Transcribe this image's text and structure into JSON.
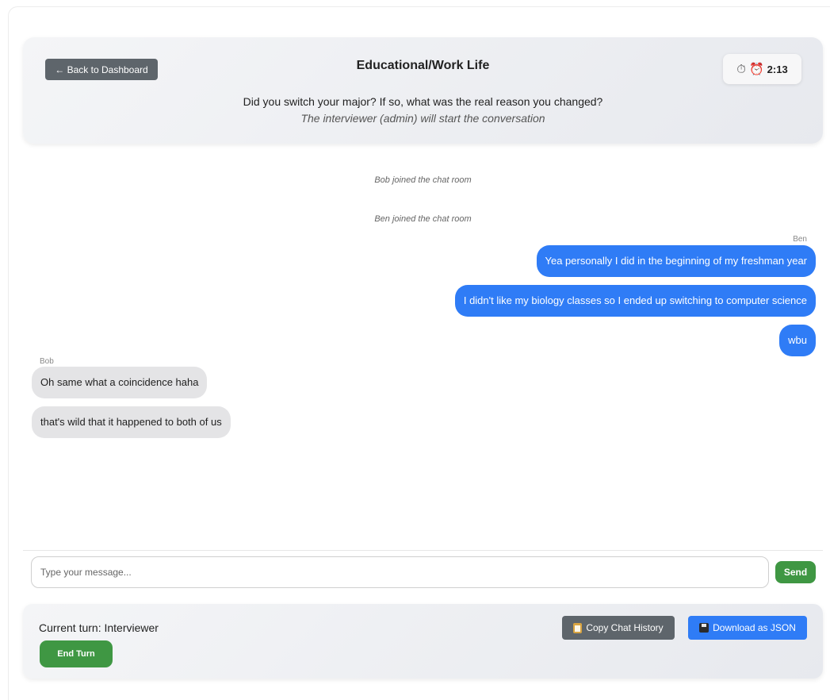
{
  "header": {
    "back_label": "← Back to Dashboard",
    "title": "Educational/Work Life",
    "question": "Did you switch your major? If so, what was the real reason you changed?",
    "note": "The interviewer (admin) will start the conversation",
    "timer": {
      "stopwatch_icon": "⏱",
      "alarm_icon": "⏰",
      "value": "2:13"
    }
  },
  "chat": {
    "system_messages": [
      "Bob joined the chat room",
      "Ben joined the chat room"
    ],
    "messages": [
      {
        "sender": "Ben",
        "text": "Yea personally I did in the beginning of my freshman year",
        "mine": true
      },
      {
        "sender": "Ben",
        "text": "I didn't like my biology classes so I ended up switching to computer science",
        "mine": true
      },
      {
        "sender": "Ben",
        "text": "wbu",
        "mine": true
      },
      {
        "sender": "Bob",
        "text": "Oh same what a coincidence haha",
        "mine": false
      },
      {
        "sender": "Bob",
        "text": "that's wild that it happened to both of us",
        "mine": false
      }
    ]
  },
  "composer": {
    "placeholder": "Type your message...",
    "send_label": "Send"
  },
  "footer": {
    "turn_label": "Current turn: Interviewer",
    "end_turn_label": "End Turn",
    "copy_label": "Copy Chat History",
    "download_label": "Download as JSON"
  },
  "colors": {
    "mine_bubble": "#2f7cf6",
    "theirs_bubble": "#e4e4e6",
    "send_green": "#3f9743",
    "back_gray": "#5e656b"
  },
  "icons": {
    "clipboard": "clipboard-icon",
    "floppy": "floppy-disk-icon"
  }
}
